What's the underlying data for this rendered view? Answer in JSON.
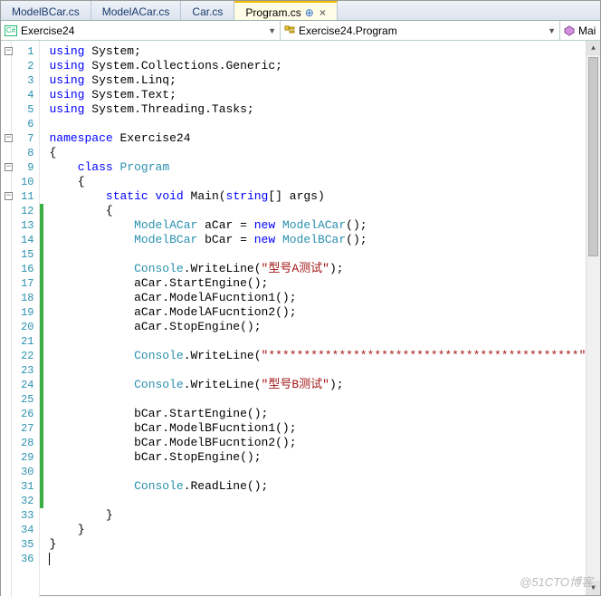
{
  "tabs": [
    {
      "label": "ModelBCar.cs",
      "active": false
    },
    {
      "label": "ModelACar.cs",
      "active": false
    },
    {
      "label": "Car.cs",
      "active": false
    },
    {
      "label": "Program.cs",
      "active": true
    }
  ],
  "nav": {
    "scope_left": "Exercise24",
    "scope_right": "Exercise24.Program",
    "right_extra": "Mai"
  },
  "code_lines": [
    {
      "n": 1,
      "indent": 0,
      "tokens": [
        [
          "kw",
          "using"
        ],
        [
          "",
          " System;"
        ]
      ]
    },
    {
      "n": 2,
      "indent": 0,
      "tokens": [
        [
          "kw",
          "using"
        ],
        [
          "",
          " System.Collections.Generic;"
        ]
      ]
    },
    {
      "n": 3,
      "indent": 0,
      "tokens": [
        [
          "kw",
          "using"
        ],
        [
          "",
          " System.Linq;"
        ]
      ]
    },
    {
      "n": 4,
      "indent": 0,
      "tokens": [
        [
          "kw",
          "using"
        ],
        [
          "",
          " System.Text;"
        ]
      ]
    },
    {
      "n": 5,
      "indent": 0,
      "tokens": [
        [
          "kw",
          "using"
        ],
        [
          "",
          " System.Threading.Tasks;"
        ]
      ]
    },
    {
      "n": 6,
      "indent": 0,
      "tokens": []
    },
    {
      "n": 7,
      "indent": 0,
      "tokens": [
        [
          "kw",
          "namespace"
        ],
        [
          "",
          " Exercise24"
        ]
      ]
    },
    {
      "n": 8,
      "indent": 0,
      "tokens": [
        [
          "",
          "{"
        ]
      ]
    },
    {
      "n": 9,
      "indent": 1,
      "tokens": [
        [
          "kw",
          "class"
        ],
        [
          "",
          " "
        ],
        [
          "type",
          "Program"
        ]
      ]
    },
    {
      "n": 10,
      "indent": 1,
      "tokens": [
        [
          "",
          "{"
        ]
      ]
    },
    {
      "n": 11,
      "indent": 2,
      "tokens": [
        [
          "kw",
          "static"
        ],
        [
          "",
          " "
        ],
        [
          "kw",
          "void"
        ],
        [
          "",
          " Main("
        ],
        [
          "kw",
          "string"
        ],
        [
          "",
          "[] args)"
        ]
      ]
    },
    {
      "n": 12,
      "indent": 2,
      "tokens": [
        [
          "",
          "{"
        ]
      ],
      "changed": true
    },
    {
      "n": 13,
      "indent": 3,
      "tokens": [
        [
          "type",
          "ModelACar"
        ],
        [
          "",
          " aCar = "
        ],
        [
          "kw",
          "new"
        ],
        [
          "",
          " "
        ],
        [
          "type",
          "ModelACar"
        ],
        [
          "",
          "();"
        ]
      ],
      "changed": true
    },
    {
      "n": 14,
      "indent": 3,
      "tokens": [
        [
          "type",
          "ModelBCar"
        ],
        [
          "",
          " bCar = "
        ],
        [
          "kw",
          "new"
        ],
        [
          "",
          " "
        ],
        [
          "type",
          "ModelBCar"
        ],
        [
          "",
          "();"
        ]
      ],
      "changed": true
    },
    {
      "n": 15,
      "indent": 0,
      "tokens": [],
      "changed": true
    },
    {
      "n": 16,
      "indent": 3,
      "tokens": [
        [
          "type",
          "Console"
        ],
        [
          "",
          ".WriteLine("
        ],
        [
          "str",
          "\"型号A测试\""
        ],
        [
          "",
          ");"
        ]
      ],
      "changed": true
    },
    {
      "n": 17,
      "indent": 3,
      "tokens": [
        [
          "",
          "aCar.StartEngine();"
        ]
      ],
      "changed": true
    },
    {
      "n": 18,
      "indent": 3,
      "tokens": [
        [
          "",
          "aCar.ModelAFucntion1();"
        ]
      ],
      "changed": true
    },
    {
      "n": 19,
      "indent": 3,
      "tokens": [
        [
          "",
          "aCar.ModelAFucntion2();"
        ]
      ],
      "changed": true
    },
    {
      "n": 20,
      "indent": 3,
      "tokens": [
        [
          "",
          "aCar.StopEngine();"
        ]
      ],
      "changed": true
    },
    {
      "n": 21,
      "indent": 0,
      "tokens": [],
      "changed": true
    },
    {
      "n": 22,
      "indent": 3,
      "tokens": [
        [
          "type",
          "Console"
        ],
        [
          "",
          ".WriteLine("
        ],
        [
          "str",
          "\"********************************************\""
        ],
        [
          "",
          ");"
        ]
      ],
      "changed": true
    },
    {
      "n": 23,
      "indent": 0,
      "tokens": [],
      "changed": true
    },
    {
      "n": 24,
      "indent": 3,
      "tokens": [
        [
          "type",
          "Console"
        ],
        [
          "",
          ".WriteLine("
        ],
        [
          "str",
          "\"型号B测试\""
        ],
        [
          "",
          ");"
        ]
      ],
      "changed": true
    },
    {
      "n": 25,
      "indent": 0,
      "tokens": [],
      "changed": true
    },
    {
      "n": 26,
      "indent": 3,
      "tokens": [
        [
          "",
          "bCar.StartEngine();"
        ]
      ],
      "changed": true
    },
    {
      "n": 27,
      "indent": 3,
      "tokens": [
        [
          "",
          "bCar.ModelBFucntion1();"
        ]
      ],
      "changed": true
    },
    {
      "n": 28,
      "indent": 3,
      "tokens": [
        [
          "",
          "bCar.ModelBFucntion2();"
        ]
      ],
      "changed": true
    },
    {
      "n": 29,
      "indent": 3,
      "tokens": [
        [
          "",
          "bCar.StopEngine();"
        ]
      ],
      "changed": true
    },
    {
      "n": 30,
      "indent": 0,
      "tokens": [],
      "changed": true
    },
    {
      "n": 31,
      "indent": 3,
      "tokens": [
        [
          "type",
          "Console"
        ],
        [
          "",
          ".ReadLine();"
        ]
      ],
      "changed": true
    },
    {
      "n": 32,
      "indent": 0,
      "tokens": [],
      "changed": true
    },
    {
      "n": 33,
      "indent": 2,
      "tokens": [
        [
          "",
          "}"
        ]
      ]
    },
    {
      "n": 34,
      "indent": 1,
      "tokens": [
        [
          "",
          "}"
        ]
      ]
    },
    {
      "n": 35,
      "indent": 0,
      "tokens": [
        [
          "",
          "}"
        ]
      ]
    },
    {
      "n": 36,
      "indent": 0,
      "tokens": []
    }
  ],
  "folds": [
    1,
    7,
    9,
    11
  ],
  "watermark": "@51CTO博客"
}
